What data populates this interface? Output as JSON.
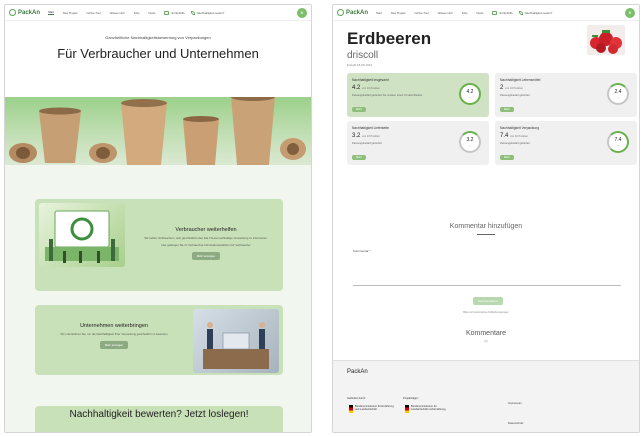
{
  "nav": {
    "logo": "PackAn",
    "items": [
      "Start",
      "Das Projekt",
      "Online-Tool",
      "Wissen-Hub",
      "FAQ",
      "News"
    ],
    "pill_sort": "Sortierhilfe",
    "pill_eval": "Nachhaltigkeit testen?",
    "avatar": "B"
  },
  "home": {
    "kicker": "Ganzheitliche Nachhaltigkeitsbewertung von Verpackungen",
    "hero_title": "Für Verbraucher und Unternehmen",
    "card_consumer": {
      "title": "Verbraucher weiterhelfen",
      "text1": "Wir helfen Verbrauchern, sich ganzheitlich über das Thema nachhaltige Verpackung zu informieren.",
      "text2": "Hier gelangen Sie zu Verbraucher-Informationsplattform für Verbraucher",
      "button": "Mehr anzeigen"
    },
    "card_business": {
      "title": "Unternehmen weiterbringen",
      "text1": "Wir unterstützen Sie, um die Nachhaltigkeit Ihrer Verpackung ganzheitlich zu bewerten",
      "button": "Mehr anzeigen"
    },
    "cta_title": "Nachhaltigkeit bewerten? Jetzt loslegen!"
  },
  "product": {
    "title": "Erdbeeren",
    "brand": "driscoll",
    "date": "Erstellt 18.05.2023",
    "metrics": [
      {
        "title": "Nachhaltigkeit insgesamt",
        "value": "4.2",
        "unit": "von 10 Punkten",
        "line": "Passungsbedarf gefordert Sie müssen einen Ort abschließen",
        "button": "Mehr",
        "ring": "4.2"
      },
      {
        "title": "Nachhaltigkeit Lebensmittel",
        "value": "2",
        "unit": "von 10 Punkten",
        "line": "Passungsbedarf gefordert",
        "button": "Mehr",
        "ring": "2.4"
      },
      {
        "title": "Nachhaltigkeit Lieferkette",
        "value": "3.2",
        "unit": "von 10 Punkten",
        "line": "Passungsbedarf gefordert",
        "button": "Mehr",
        "ring": "3.2"
      },
      {
        "title": "Nachhaltigkeit Verpackung",
        "value": "7.4",
        "unit": "von 10 Punkten",
        "line": "Passungsbedarf gefordert",
        "button": "Mehr",
        "ring": "7.4"
      }
    ],
    "comment_title": "Kommentar hinzufügen",
    "comment_label": "Kommentar *",
    "comment_button": "Kommentieren",
    "comment_hint": "Bitte nur konstruktive Kritik/Anregungen",
    "comments_title": "Kommentare",
    "comments_count": "(0)"
  },
  "footer": {
    "brand": "PackAn",
    "funded_by": "Gefördert durch:",
    "project_owner": "Projektträger:",
    "ministry1": "Bundesministerium für Ernährung und Landwirtschaft",
    "ministry2": "Bundesministerium für Landwirtschaft und Ernährung",
    "impressum": "Impressum",
    "datenschutz": "Datenschutz"
  },
  "colors": {
    "accent": "#3d7a3d",
    "card_green": "#c9e1b8",
    "metric_green": "#cfe2c4"
  }
}
